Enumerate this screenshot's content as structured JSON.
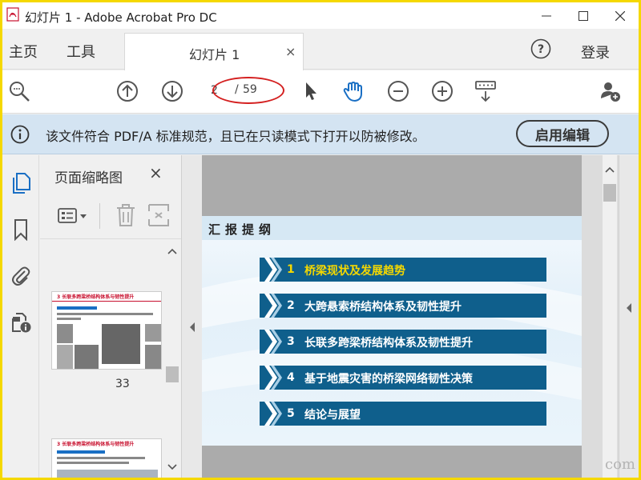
{
  "window": {
    "title": "幻灯片 1 - Adobe Acrobat Pro DC"
  },
  "menu": {
    "home": "主页",
    "tools": "工具",
    "login": "登录"
  },
  "tab": {
    "label": "幻灯片 1",
    "close": "×"
  },
  "toolbar": {
    "current_page": "2",
    "separator": "/",
    "total_pages": "59"
  },
  "infobar": {
    "message": "该文件符合 PDF/A 标准规范，且已在只读模式下打开以防被修改。",
    "enable_edit": "启用编辑"
  },
  "thumbnails": {
    "title": "页面缩略图",
    "close": "×",
    "items": [
      {
        "page": "33",
        "header": "3 长联多跨梁桥结构体系与韧性提升"
      },
      {
        "header": "3 长联多跨梁桥结构体系与韧性提升"
      }
    ]
  },
  "slide": {
    "title": "汇报提纲",
    "items": [
      {
        "num": "1",
        "label": "桥梁现状及发展趋势",
        "highlight": true
      },
      {
        "num": "2",
        "label": "大跨悬索桥结构体系及韧性提升"
      },
      {
        "num": "3",
        "label": "长联多跨梁桥结构体系及韧性提升"
      },
      {
        "num": "4",
        "label": "基于地震灾害的桥梁网络韧性决策"
      },
      {
        "num": "5",
        "label": "结论与展望"
      }
    ]
  },
  "watermark": "com",
  "colors": {
    "accent_blue": "#0f5f8c",
    "highlight_text": "#f5d800",
    "info_bar": "#d4e4f2",
    "annotation_red": "#d42020",
    "frame_yellow": "#f5d800"
  }
}
